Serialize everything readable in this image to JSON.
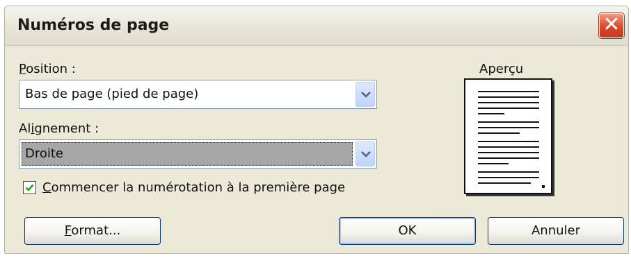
{
  "dialog": {
    "title": "Numéros de page",
    "close_glyph": "✕"
  },
  "position": {
    "label_first": "P",
    "label_rest": "osition :",
    "value": "Bas de page (pied de page)"
  },
  "alignment": {
    "label_first": "Al",
    "label_accel": "i",
    "label_rest": "gnement :",
    "value": "Droite"
  },
  "first_page": {
    "checked": true,
    "label_accel": "C",
    "label_rest": "ommencer la numérotation à la première page"
  },
  "preview": {
    "title": "Aperçu"
  },
  "buttons": {
    "format_accel": "F",
    "format_rest": "ormat...",
    "ok": "OK",
    "cancel": "Annuler"
  },
  "colors": {
    "dialog_bg": "#ece9d8",
    "close_red": "#d8492a",
    "field_border": "#7f9db9",
    "selection_grey": "#a7a7a7"
  },
  "icons": [
    "close-icon",
    "chevron-down-icon",
    "checkmark-icon",
    "page-preview-icon"
  ]
}
